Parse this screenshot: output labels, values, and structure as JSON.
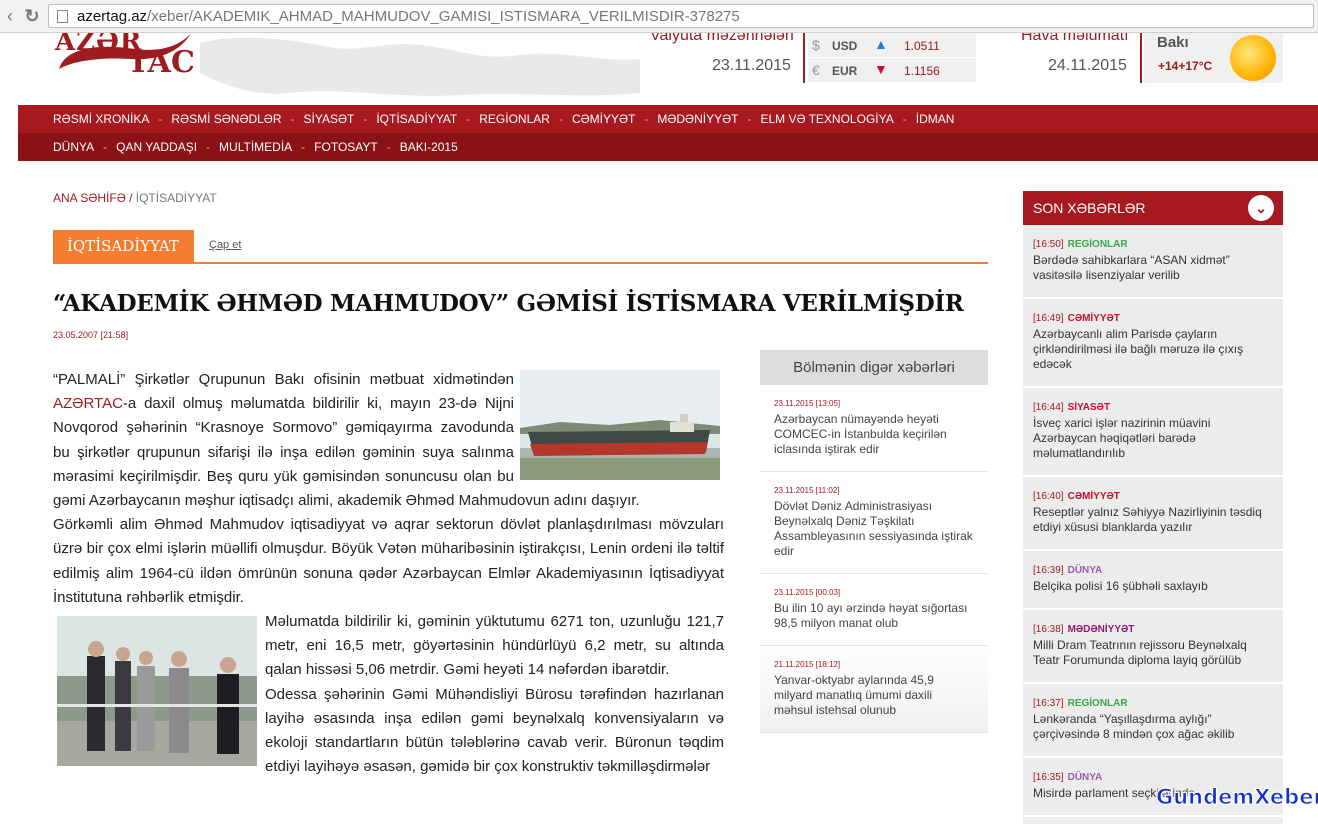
{
  "browser": {
    "url_host": "azertag.az",
    "url_path": "/xeber/AKADEMIK_AHMAD_MAHMUDOV_GAMISI_ISTISMARA_VERILMISDIR-378275"
  },
  "header": {
    "logo_top": "AZƏR",
    "logo_bottom": "TAC",
    "currency_label": "Valyuta məzənnələri",
    "currency_date": "23.11.2015",
    "currencies": [
      {
        "symbol": "$",
        "code": "USD",
        "direction": "up",
        "arrow": "▲",
        "arrow_color": "#2a7fc9",
        "value": "1.0511"
      },
      {
        "symbol": "€",
        "code": "EUR",
        "direction": "down",
        "arrow": "▼",
        "arrow_color": "#c8102e",
        "value": "1.1156"
      }
    ],
    "weather_label": "Hava məlumatı",
    "weather_date": "24.11.2015",
    "weather_city": "Bakı",
    "weather_temp": "+14+17°C",
    "weather_icon": "sun-icon"
  },
  "nav": {
    "row1": [
      "RƏSMİ XRONİKA",
      "RƏSMİ SƏNƏDLƏR",
      "SİYASƏT",
      "İQTİSADİYYAT",
      "REGİONLAR",
      "CƏMİYYƏT",
      "MƏDƏNİYYƏT",
      "ELM VƏ TEXNOLOGİYA",
      "İDMAN"
    ],
    "row2": [
      "DÜNYA",
      "QAN YADDAŞI",
      "MULTİMEDİA",
      "FOTOSAYT",
      "BAKI-2015"
    ]
  },
  "breadcrumb": {
    "home": "ANA SƏHİFƏ",
    "sep": " / ",
    "current": "İQTİSADİYYAT"
  },
  "section_tab": "İQTİSADİYYAT",
  "print_label": "Çap et",
  "article": {
    "title": "“AKADEMİK ƏHMƏD MAHMUDOV” GƏMİSİ İSTİSMARA VERİLMİŞDİR",
    "date": "23.05.2007 [21:58]",
    "p1_a": "“PALMALİ” Şirkətlər Qrupunun Bakı ofisinin mətbuat xidmətindən ",
    "p1_link": "AZƏRTAC",
    "p1_b": "-a daxil olmuş məlumatda bildirilir ki, mayın 23-də Nijni Novqorod şəhərinin “Krasnoye Sormovo” gəmiqayırma zavodunda bu şirkətlər qrupunun sifarişi ilə inşa edilən gəminin suya salınma mərasimi keçirilmişdir. Beş quru yük gəmisindən sonuncusu olan bu gəmi Azərbaycanın məşhur iqtisadçı alimi, akademik Əhməd Mahmudovun adını daşıyır.",
    "p2": "Görkəmli alim Əhməd Mahmudov iqtisadiyyat və aqrar sektorun dövlət planlaşdırılması mövzuları üzrə bir çox elmi işlərin müəllifi olmuşdur. Böyük Vətən müharibəsinin iştirakçısı, Lenin ordeni ilə təltif edilmiş alim 1964-cü ildən ömrünün sonuna qədər Azərbaycan Elmlər Akademiyasının İqtisadiyyat İnstitutuna rəhbərlik etmişdir.",
    "p3": "Məlumatda bildirilir ki, gəminin yüktutumu 6271 ton, uzunluğu 121,7 metr, eni 16,5 metr, göyərtəsinin hündürlüyü 6,2 metr, su altında qalan hissəsi 5,06 metrdir. Gəmi heyəti 14 nəfərdən ibarətdir.",
    "p4": "Odessa şəhərinin Gəmi Mühəndisliyi Bürosu tərəfindən hazırlanan layihə əsasında inşa edilən gəmi beynəlxalq konvensiyaların və ekoloji standartların bütün tələblərinə cavab verir. Büronun təqdim etdiyi layihəyə əsasən, gəmidə bir çox konstruktiv təkmilləşdirmələr"
  },
  "other_news": {
    "title": "Bölmənin digər xəbərləri",
    "items": [
      {
        "date": "23.11.2015 [13:05]",
        "text": "Azərbaycan nümayəndə heyəti COMCEC-in İstanbulda keçirilən iclasında iştirak edir"
      },
      {
        "date": "23.11.2015 [11:02]",
        "text": "Dövlət Dəniz Administrasiyası Beynəlxalq Dəniz Təşkilatı Assambleyasının sessiyasında iştirak edir"
      },
      {
        "date": "23.11.2015 [00:03]",
        "text": "Bu ilin 10 ayı ərzində həyat sığortası 98,5 milyon manat olub"
      },
      {
        "date": "21.11.2015 [18:12]",
        "text": "Yanvar-oktyabr aylarında 45,9 milyard manatlıq ümumi daxili məhsul istehsal olunub"
      }
    ]
  },
  "latest": {
    "title": "SON XƏBƏRLƏR",
    "items": [
      {
        "time": "[16:50]",
        "category": "REGİONLAR",
        "color": "#3aa64a",
        "text": "Bərdədə sahibkarlara “ASAN xidmət” vasitəsilə lisenziyalar verilib"
      },
      {
        "time": "[16:49]",
        "category": "CƏMİYYƏT",
        "color": "#c8102e",
        "text": "Azərbaycanlı alim Parisdə çayların çirkləndirilməsi ilə bağlı məruzə ilə çıxış edəcək"
      },
      {
        "time": "[16:44]",
        "category": "SİYASƏT",
        "color": "#c8102e",
        "text": "İsveç xarici işlər nazirinin müavini Azərbaycan həqiqətləri barədə məlumatlandırılıb"
      },
      {
        "time": "[16:40]",
        "category": "CƏMİYYƏT",
        "color": "#c8102e",
        "text": "Reseptlər yalnız Səhiyyə Nazirliyinin təsdiq etdiyi xüsusi blanklarda yazılır"
      },
      {
        "time": "[16:39]",
        "category": "DÜNYA",
        "color": "#9b59b6",
        "text": "Belçika polisi 16 şübhəli saxlayıb"
      },
      {
        "time": "[16:38]",
        "category": "MƏDƏNİYYƏT",
        "color": "#8e1a6e",
        "text": "Milli Dram Teatrının rejissoru Beynəlxalq Teatr Forumunda diploma layiq görülüb"
      },
      {
        "time": "[16:37]",
        "category": "REGİONLAR",
        "color": "#3aa64a",
        "text": "Lənkəranda “Yaşıllaşdırma aylığı” çərçivəsində 8 mindən çox ağac əkilib"
      },
      {
        "time": "[16:35]",
        "category": "DÜNYA",
        "color": "#9b59b6",
        "text": "Misirdə parlament seçkilərində"
      }
    ]
  },
  "watermark": "GundemXeber.Az"
}
